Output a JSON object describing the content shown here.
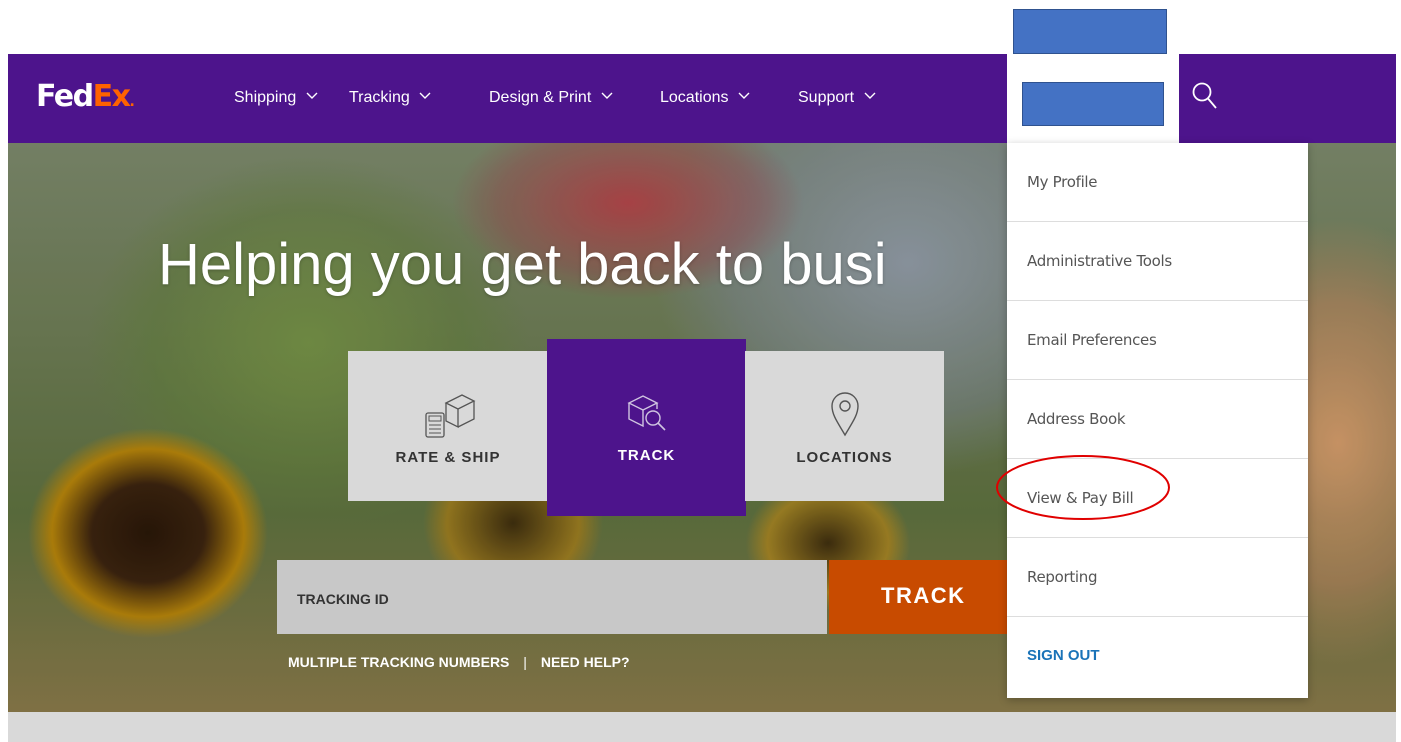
{
  "brand": {
    "logo_part1": "Fed",
    "logo_part2": "Ex",
    "logo_dot": "."
  },
  "nav": {
    "items": [
      {
        "label": "Shipping"
      },
      {
        "label": "Tracking"
      },
      {
        "label": "Design & Print"
      },
      {
        "label": "Locations"
      },
      {
        "label": "Support"
      }
    ]
  },
  "hero": {
    "headline": "Helping you get back to busi"
  },
  "tiles": [
    {
      "label": "RATE & SHIP",
      "icon": "rate-ship-icon"
    },
    {
      "label": "TRACK",
      "icon": "package-search-icon"
    },
    {
      "label": "LOCATIONS",
      "icon": "location-pin-icon"
    }
  ],
  "tracking": {
    "input_label": "TRACKING ID",
    "button_label": "TRACK",
    "link_multiple": "MULTIPLE TRACKING NUMBERS",
    "separator": "|",
    "link_help": "NEED HELP?"
  },
  "account_menu": {
    "items": [
      {
        "label": "My Profile"
      },
      {
        "label": "Administrative Tools"
      },
      {
        "label": "Email Preferences"
      },
      {
        "label": "Address Book"
      },
      {
        "label": "View & Pay Bill"
      },
      {
        "label": "Reporting"
      },
      {
        "label": "SIGN OUT"
      }
    ]
  },
  "colors": {
    "brand_purple": "#4d148c",
    "brand_orange": "#ff6200",
    "track_button": "#c84b00",
    "redaction_blue": "#4472c4",
    "annotation_red": "#e00000",
    "sign_out_blue": "#1a73b8"
  }
}
